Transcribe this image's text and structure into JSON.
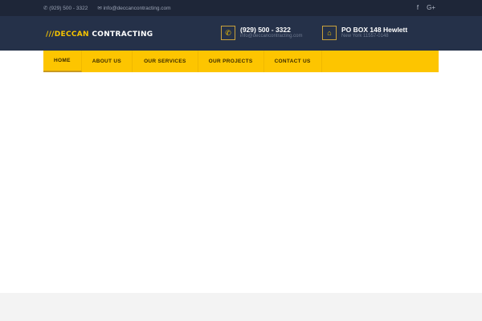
{
  "topbar": {
    "phone": "(929) 500 - 3322",
    "email": "info@deccancontracting.com",
    "social": [
      "f",
      "G+"
    ]
  },
  "logo": {
    "slashes": "///",
    "part1": "DECCAN",
    "part2": "CONTRACTING"
  },
  "contact": {
    "phone": "(929) 500 - 3322",
    "email": "info@deccancontracting.com"
  },
  "address": {
    "line1": "PO BOX 148 Hewlett",
    "line2": "New York 11557-0148"
  },
  "nav": [
    "HOME",
    "ABOUT US",
    "OUR SERVICES",
    "OUR PROJECTS",
    "CONTACT US"
  ]
}
